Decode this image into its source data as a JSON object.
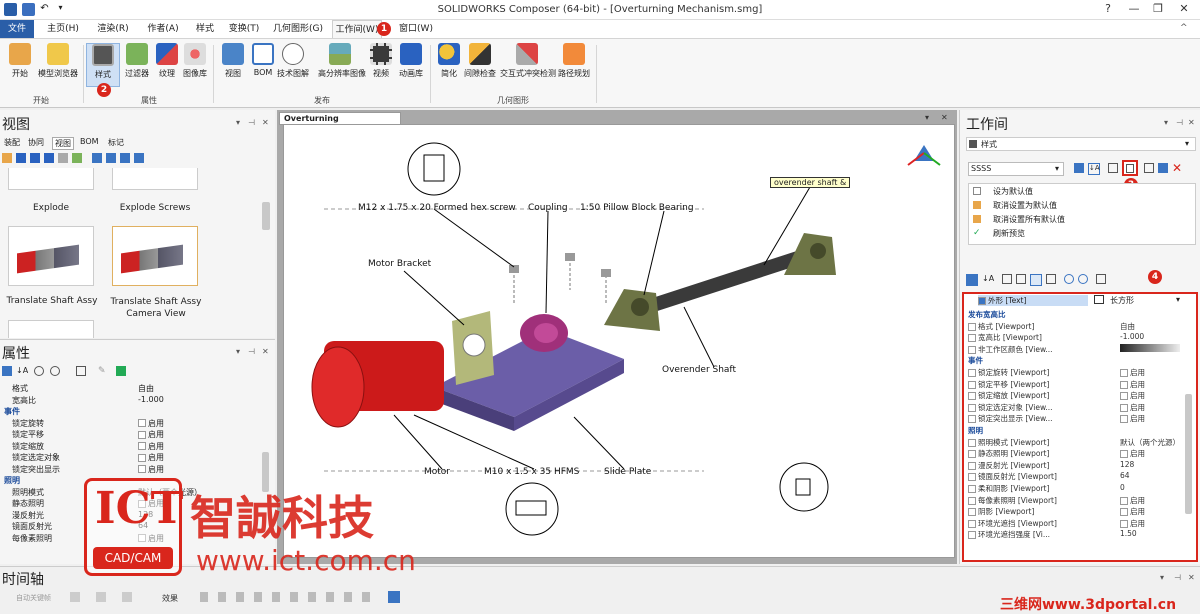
{
  "window": {
    "title": "SOLIDWORKS Composer (64-bit) - [Overturning Mechanism.smg]"
  },
  "tabs": [
    {
      "label": "文件"
    },
    {
      "label": "主页(H)"
    },
    {
      "label": "渲染(R)"
    },
    {
      "label": "作者(A)"
    },
    {
      "label": "样式"
    },
    {
      "label": "变换(T)"
    },
    {
      "label": "几何图形(G)"
    },
    {
      "label": "工作间(W)"
    },
    {
      "label": "窗口(W)"
    }
  ],
  "badges": {
    "b1": "1",
    "b2": "2",
    "b3": "3",
    "b4": "4"
  },
  "ribbon": {
    "groups": [
      {
        "label": "开始"
      },
      {
        "label": "属性"
      },
      {
        "label": "发布"
      },
      {
        "label": "几何图形"
      }
    ],
    "buttons": [
      {
        "label": "开始"
      },
      {
        "label": "模型浏览器"
      },
      {
        "label": "样式"
      },
      {
        "label": "过滤器"
      },
      {
        "label": "纹理"
      },
      {
        "label": "图像库"
      },
      {
        "label": "视图"
      },
      {
        "label": "BOM"
      },
      {
        "label": "技术图解"
      },
      {
        "label": "高分辨率图像"
      },
      {
        "label": "视频"
      },
      {
        "label": "动画库"
      },
      {
        "label": "简化"
      },
      {
        "label": "间隙检查"
      },
      {
        "label": "交互式冲突检测"
      },
      {
        "label": "路径规划"
      }
    ]
  },
  "left": {
    "views_title": "视图",
    "subtabs": [
      "装配",
      "协同",
      "视图",
      "BOM",
      "标记"
    ],
    "thumbs": [
      {
        "label": "Explode"
      },
      {
        "label": "Explode Screws"
      },
      {
        "label": "Translate Shaft Assy"
      },
      {
        "label": "Translate Shaft Assy Camera View"
      }
    ],
    "props_title": "属性",
    "props": [
      {
        "name": "格式",
        "value": "自由",
        "type": "row"
      },
      {
        "name": "宽高比",
        "value": "-1.000",
        "type": "row"
      },
      {
        "name": "事件",
        "value": "",
        "type": "cat"
      },
      {
        "name": "锁定旋转",
        "value": "启用",
        "type": "chk"
      },
      {
        "name": "锁定平移",
        "value": "启用",
        "type": "chk"
      },
      {
        "name": "锁定缩放",
        "value": "启用",
        "type": "chk"
      },
      {
        "name": "锁定选定对象",
        "value": "启用",
        "type": "chk"
      },
      {
        "name": "锁定突出显示",
        "value": "启用",
        "type": "chk"
      },
      {
        "name": "照明",
        "value": "",
        "type": "cat"
      },
      {
        "name": "照明模式",
        "value": "默认（两个光源）",
        "type": "row"
      },
      {
        "name": "静态照明",
        "value": "启用",
        "type": "chk"
      },
      {
        "name": "漫反射光",
        "value": "128",
        "type": "row"
      },
      {
        "name": "镜面反射光",
        "value": "64",
        "type": "row"
      },
      {
        "name": "每像素照明",
        "value": "启用",
        "type": "chk"
      }
    ]
  },
  "document": {
    "tab_label": "Overturning Mechanism.smg",
    "callouts": [
      {
        "text": "M12 x 1.75 x 20 Formed hex screw"
      },
      {
        "text": "Coupling"
      },
      {
        "text": "1:50 Pillow Block Bearing"
      },
      {
        "text": "Motor Bracket"
      },
      {
        "text": "Overender Shaft"
      },
      {
        "text": "Motor"
      },
      {
        "text": "M10 x 1.5 x 35 HFMS"
      },
      {
        "text": "Slide Plate"
      }
    ],
    "tooltip": "overender shaft &"
  },
  "right": {
    "title": "工作间",
    "dropdown": "样式",
    "style_name": "SSSS",
    "menu": [
      "设为默认值",
      "取消设置为默认值",
      "取消设置所有默认值",
      "刷新预览"
    ],
    "head_name": "外形 [Text]",
    "head_value": "长方形",
    "rows": [
      {
        "name": "发布宽高比",
        "value": "",
        "type": "cat"
      },
      {
        "name": "格式 [Viewport]",
        "value": "自由",
        "type": "row"
      },
      {
        "name": "宽高比 [Viewport]",
        "value": "-1.000",
        "type": "row"
      },
      {
        "name": "非工作区颜色 [View...",
        "value": "",
        "type": "row"
      },
      {
        "name": "事件",
        "value": "",
        "type": "cat"
      },
      {
        "name": "锁定旋转 [Viewport]",
        "value": "启用",
        "type": "row"
      },
      {
        "name": "锁定平移 [Viewport]",
        "value": "启用",
        "type": "row"
      },
      {
        "name": "锁定缩放 [Viewport]",
        "value": "启用",
        "type": "row"
      },
      {
        "name": "锁定选定对象 [View...",
        "value": "启用",
        "type": "row"
      },
      {
        "name": "锁定突出显示 [View...",
        "value": "启用",
        "type": "row"
      },
      {
        "name": "照明",
        "value": "",
        "type": "cat"
      },
      {
        "name": "照明模式 [Viewport]",
        "value": "默认（两个光源）",
        "type": "row"
      },
      {
        "name": "静态照明 [Viewport]",
        "value": "启用",
        "type": "row"
      },
      {
        "name": "漫反射光 [Viewport]",
        "value": "128",
        "type": "row"
      },
      {
        "name": "镜面反射光 [Viewport]",
        "value": "64",
        "type": "row"
      },
      {
        "name": "柔和阴影 [Viewport]",
        "value": "0",
        "type": "row"
      },
      {
        "name": "每像素照明 [Viewport]",
        "value": "启用",
        "type": "row"
      },
      {
        "name": "阴影 [Viewport]",
        "value": "启用",
        "type": "row"
      },
      {
        "name": "环境光遮挡 [Viewport]",
        "value": "启用",
        "type": "row"
      },
      {
        "name": "环境光遮挡强度 [Vi...",
        "value": "1.50",
        "type": "row"
      }
    ]
  },
  "timeline": {
    "title": "时间轴",
    "auto_keys": "自动关键帧",
    "effects": "效果"
  },
  "watermark": {
    "brand": "ICT",
    "sub": "CAD/CAM",
    "cn": "智誠科技",
    "url": "www.ict.com.cn",
    "portal": "三维网www.3dportal.cn"
  },
  "colors": {
    "accent": "#2a5ea8",
    "badge": "#d9261c",
    "motor": "#cc1a1a",
    "bracket": "#b3b87a",
    "plate": "#6b5ea8"
  }
}
